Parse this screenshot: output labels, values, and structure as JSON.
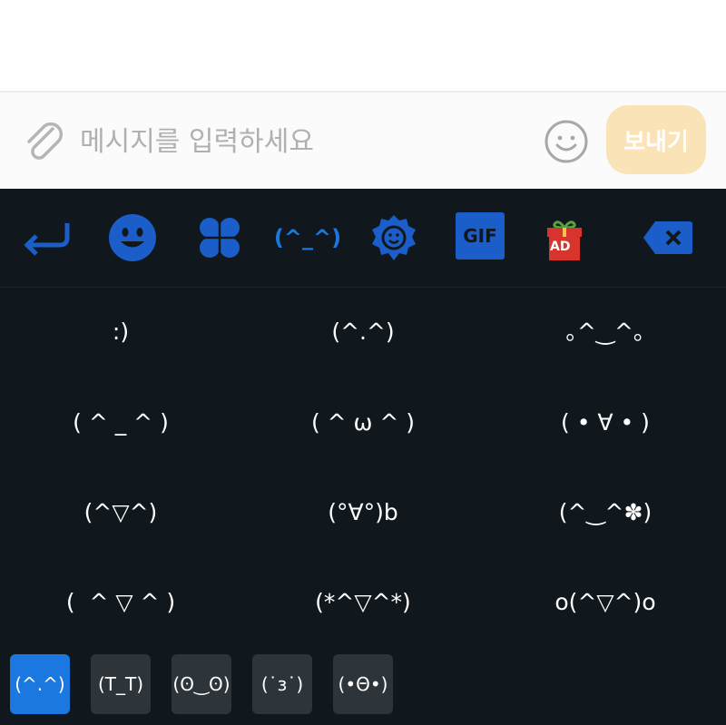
{
  "composer": {
    "placeholder": "메시지를 입력하세요",
    "send_label": "보내기",
    "send_color": "#fbe3b8"
  },
  "keyboard": {
    "background": "#11181d",
    "accent": "#1b5ec9",
    "toolbar": {
      "icons": [
        "return-icon",
        "smiley-icon",
        "clover-icon",
        "kaomoji-icon",
        "sticker-icon",
        "gif-icon",
        "gift-ad-icon",
        "backspace-icon"
      ],
      "kaomoji_label": "(^_^)",
      "gif_label": "GIF",
      "ad_label": "AD"
    },
    "kaomoji": [
      ":)",
      "(^.^)",
      "｡^‿^｡",
      "( ^ _ ^ )",
      "( ^ ω ^ )",
      "( • ∀ • )",
      "(^▽^)",
      "(°∀°)b",
      "(^‿^✽)",
      "(  ^ ▽ ^ )",
      "(*^▽^*)",
      "o(^▽^)o"
    ],
    "categories": [
      {
        "label": "(^.^)",
        "active": true
      },
      {
        "label": "(T_T)",
        "active": false
      },
      {
        "label": "(ʘ‿ʘ)",
        "active": false
      },
      {
        "label": "(˙з˙)",
        "active": false
      },
      {
        "label": "(•Θ•)",
        "active": false
      }
    ]
  }
}
